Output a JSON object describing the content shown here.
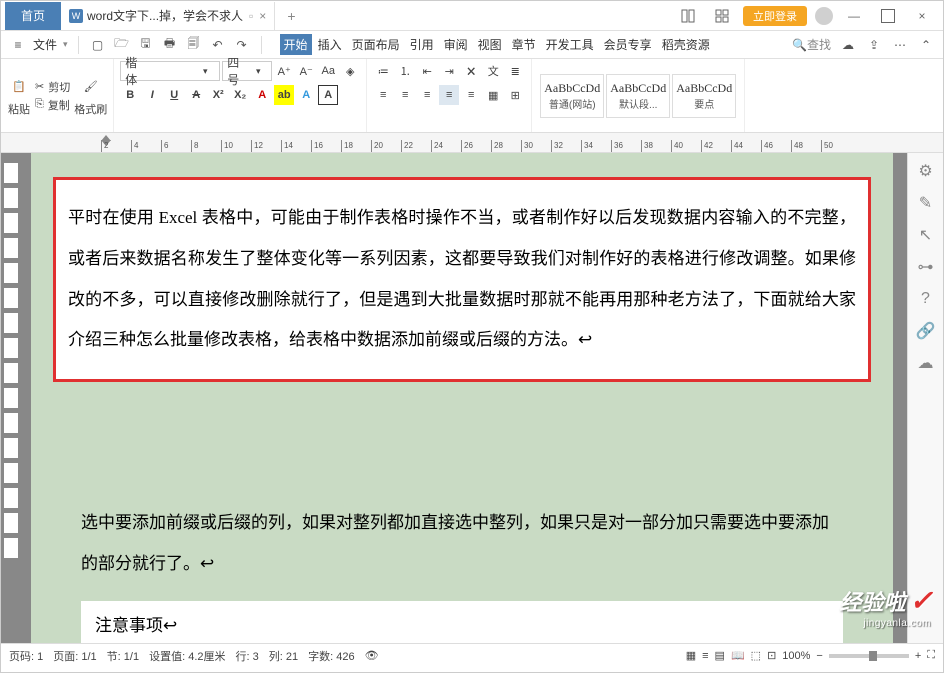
{
  "titlebar": {
    "home": "首页",
    "doc_prefix": "W",
    "doc_title": "word文字下...掉，学会不求人",
    "login": "立即登录"
  },
  "menubar": {
    "file": "文件",
    "tabs": [
      "开始",
      "插入",
      "页面布局",
      "引用",
      "审阅",
      "视图",
      "章节",
      "开发工具",
      "会员专享",
      "稻壳资源"
    ],
    "search": "查找"
  },
  "ribbon": {
    "paste": "粘贴",
    "cut": "剪切",
    "copy": "复制",
    "format_painter": "格式刷",
    "font_name": "楷体",
    "font_size": "四号",
    "styles": [
      {
        "preview": "AaBbCcDd",
        "label": "普通(网站)"
      },
      {
        "preview": "AaBbCcDd",
        "label": "默认段..."
      },
      {
        "preview": "AaBbCcDd",
        "label": "要点"
      }
    ]
  },
  "ruler": {
    "marks": [
      2,
      4,
      6,
      8,
      10,
      12,
      14,
      16,
      18,
      20,
      22,
      24,
      26,
      28,
      30,
      32,
      34,
      36,
      38,
      40,
      42,
      44,
      46,
      48,
      50
    ]
  },
  "document": {
    "highlight": "平时在使用 Excel 表格中，可能由于制作表格时操作不当，或者制作好以后发现数据内容输入的不完整，或者后来数据名称发生了整体变化等一系列因素，这都要导致我们对制作好的表格进行修改调整。如果修改的不多，可以直接修改删除就行了，但是遇到大批量数据时那就不能再用那种老方法了，下面就给大家介绍三种怎么批量修改表格，给表格中数据添加前缀或后缀的方法。↩",
    "para2": "选中要添加前缀或后缀的列，如果对整列都加直接选中整列，如果只是对一部分加只需要选中要添加的部分就行了。↩",
    "para3": "注意事项↩"
  },
  "statusbar": {
    "page_label": "页码:",
    "page_val": "1",
    "pages_label": "页面:",
    "pages_val": "1/1",
    "section_label": "节:",
    "section_val": "1/1",
    "set_label": "设置值:",
    "set_val": "4.2厘米",
    "row_label": "行:",
    "row_val": "3",
    "col_label": "列:",
    "col_val": "21",
    "words_label": "字数:",
    "words_val": "426",
    "zoom": "100%"
  },
  "watermark": {
    "text": "经验啦",
    "url": "jingyanla.com"
  }
}
